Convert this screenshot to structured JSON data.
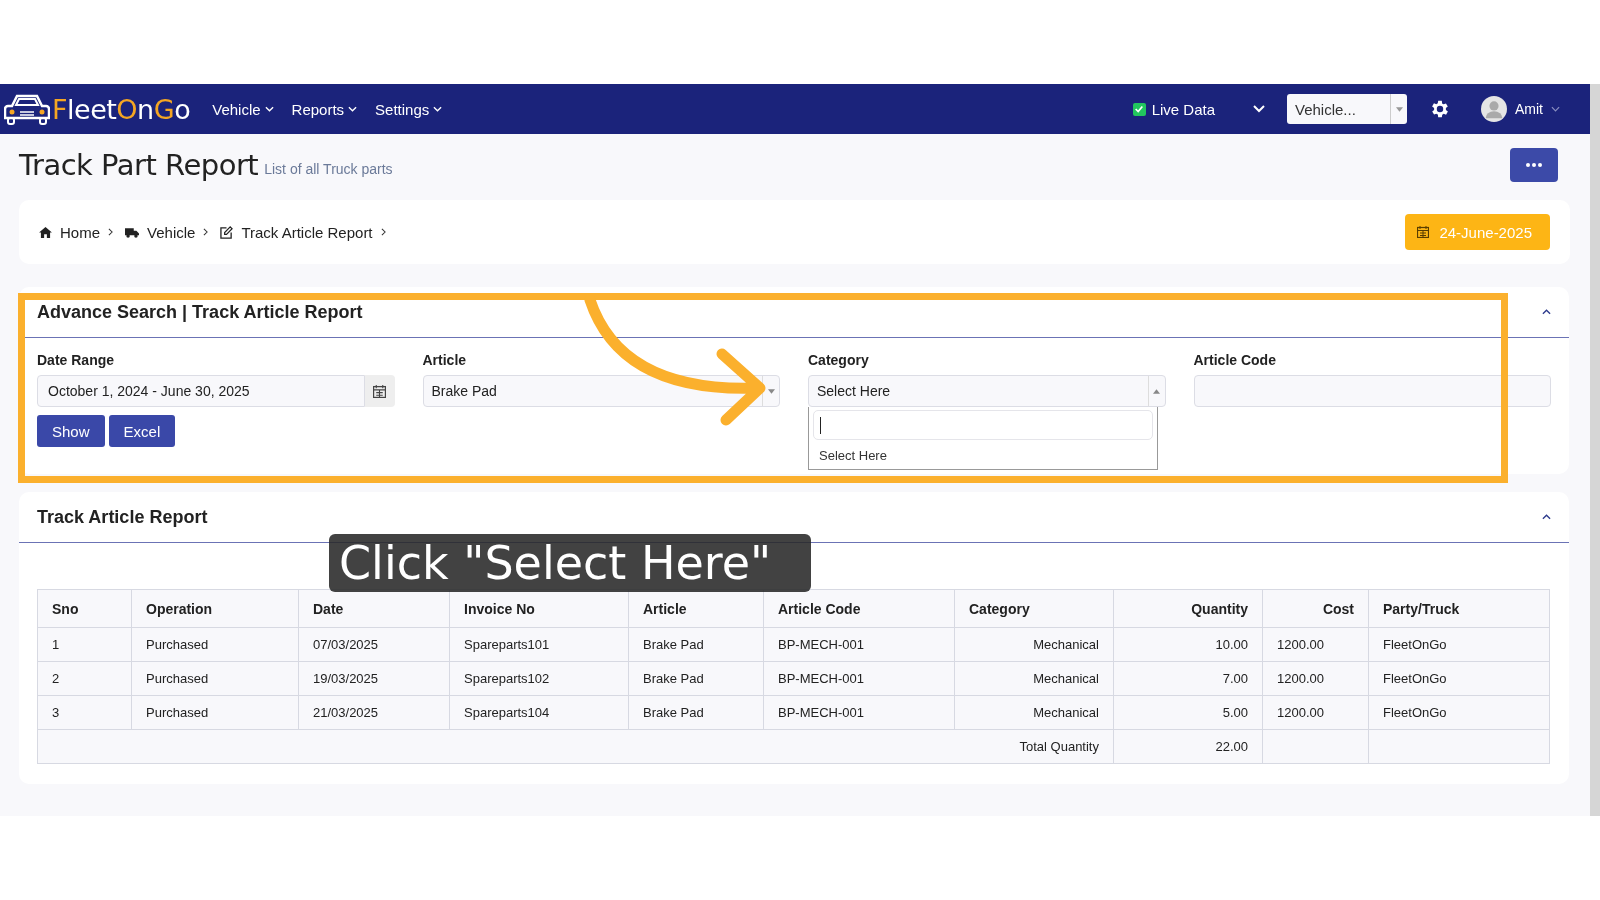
{
  "navbar": {
    "logo": [
      {
        "text": "F",
        "accent": true
      },
      {
        "text": "leet",
        "accent": false
      },
      {
        "text": "O",
        "accent": true
      },
      {
        "text": "n",
        "accent": false
      },
      {
        "text": "G",
        "accent": true
      },
      {
        "text": "o",
        "accent": false
      }
    ],
    "menus": [
      {
        "label": "Vehicle"
      },
      {
        "label": "Reports"
      },
      {
        "label": "Settings"
      }
    ],
    "live_data": {
      "label": "Live Data",
      "checked": true
    },
    "vehicle_select": {
      "value": "Vehicle..."
    },
    "user": {
      "name": "Amit"
    }
  },
  "page": {
    "title": "Track Part Report",
    "subtitle": "List of all Truck parts"
  },
  "breadcrumb": [
    {
      "label": "Home"
    },
    {
      "label": "Vehicle"
    },
    {
      "label": "Track Article Report"
    }
  ],
  "date_badge": "24-June-2025",
  "search_panel": {
    "title": "Advance Search | Track Article Report",
    "expanded": true,
    "fields": [
      {
        "label": "Date Range",
        "kind": "date",
        "value": "October 1, 2024 - June 30, 2025"
      },
      {
        "label": "Article",
        "kind": "select",
        "value": "Brake Pad",
        "expanded": false
      },
      {
        "label": "Category",
        "kind": "select",
        "value": "Select Here",
        "expanded": true,
        "options": [
          "Select Here"
        ]
      },
      {
        "label": "Article Code",
        "kind": "text"
      }
    ],
    "buttons": [
      "Show",
      "Excel"
    ]
  },
  "report_panel": {
    "title": "Track Article Report",
    "expanded": true,
    "table": {
      "columns": [
        "Sno",
        "Operation",
        "Date",
        "Invoice No",
        "Article",
        "Article Code",
        "Category",
        "Quantity",
        "Cost",
        "Party/Truck"
      ],
      "rows": [
        [
          "1",
          "Purchased",
          "07/03/2025",
          "Spareparts101",
          "Brake Pad",
          "BP-MECH-001",
          "Mechanical",
          "10.00",
          "1200.00",
          "FleetOnGo"
        ],
        [
          "2",
          "Purchased",
          "19/03/2025",
          "Spareparts102",
          "Brake Pad",
          "BP-MECH-001",
          "Mechanical",
          "7.00",
          "1200.00",
          "FleetOnGo"
        ],
        [
          "3",
          "Purchased",
          "21/03/2025",
          "Spareparts104",
          "Brake Pad",
          "BP-MECH-001",
          "Mechanical",
          "5.00",
          "1200.00",
          "FleetOnGo"
        ]
      ],
      "total": {
        "label": "Total Quantity",
        "value": "22.00"
      }
    }
  },
  "tutorial": {
    "caption": "Click \"Select Here\""
  }
}
